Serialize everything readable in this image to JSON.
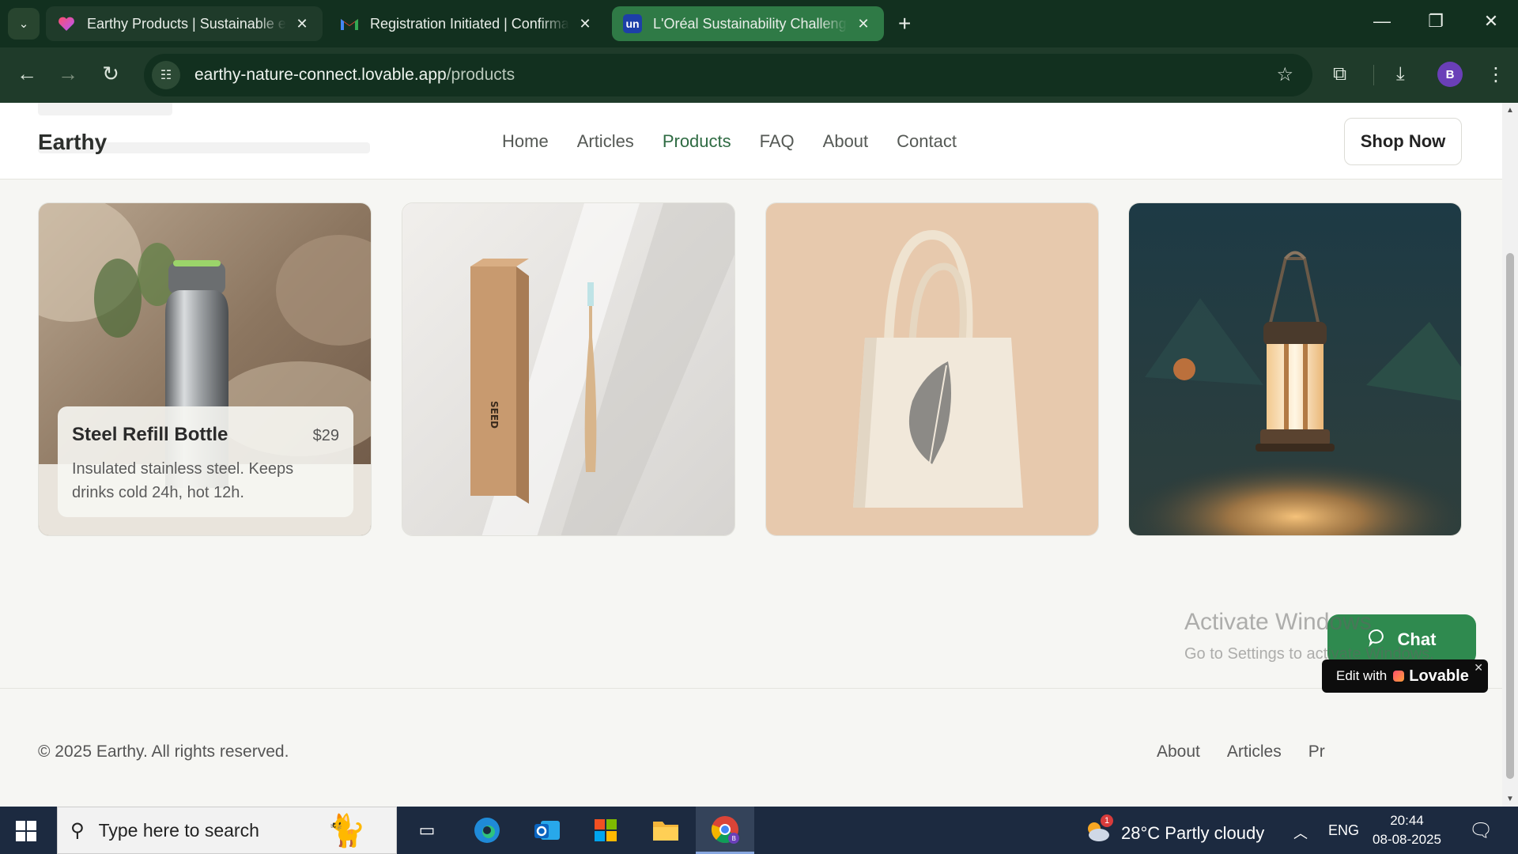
{
  "browser": {
    "tabs": [
      {
        "title": "Earthy Products | Sustainable ev",
        "icon": "lovable-heart-icon",
        "active": true
      },
      {
        "title": "Registration Initiated | Confirma",
        "icon": "gmail-icon",
        "active": false
      },
      {
        "title": "L'Oréal Sustainability Challenge",
        "icon": "unstop-icon",
        "icon_text": "un",
        "active": false
      }
    ],
    "url_host": "earthy-nature-connect.lovable.app",
    "url_path": "/products",
    "profile_initial": "B",
    "accent_color": "#1f3b2a"
  },
  "site": {
    "brand": "Earthy",
    "nav": [
      "Home",
      "Articles",
      "Products",
      "FAQ",
      "About",
      "Contact"
    ],
    "active_nav": "Products",
    "shop_button": "Shop Now",
    "accent_color": "#2f6b43"
  },
  "products": [
    {
      "name": "Steel Refill Bottle",
      "price": "$29",
      "description": "Insulated stainless steel. Keeps drinks cold 24h, hot 12h.",
      "image": "steel-bottle"
    },
    {
      "image": "bamboo-toothbrush"
    },
    {
      "image": "canvas-tote-bag"
    },
    {
      "image": "lantern"
    }
  ],
  "box_text": "SEED",
  "footer": {
    "copyright": "© 2025 Earthy. All rights reserved.",
    "links": [
      "About",
      "Articles",
      "Pr"
    ]
  },
  "overlays": {
    "activate_title": "Activate Windows",
    "activate_sub": "Go to Settings to activate Windows.",
    "chat_label": "Chat",
    "lovable_prefix": "Edit with",
    "lovable_name": "Lovable",
    "chat_color": "#2f8a4f"
  },
  "taskbar": {
    "search_placeholder": "Type here to search",
    "weather": "28°C  Partly cloudy",
    "weather_badge": "1",
    "language": "ENG",
    "time": "20:44",
    "date": "08-08-2025"
  }
}
